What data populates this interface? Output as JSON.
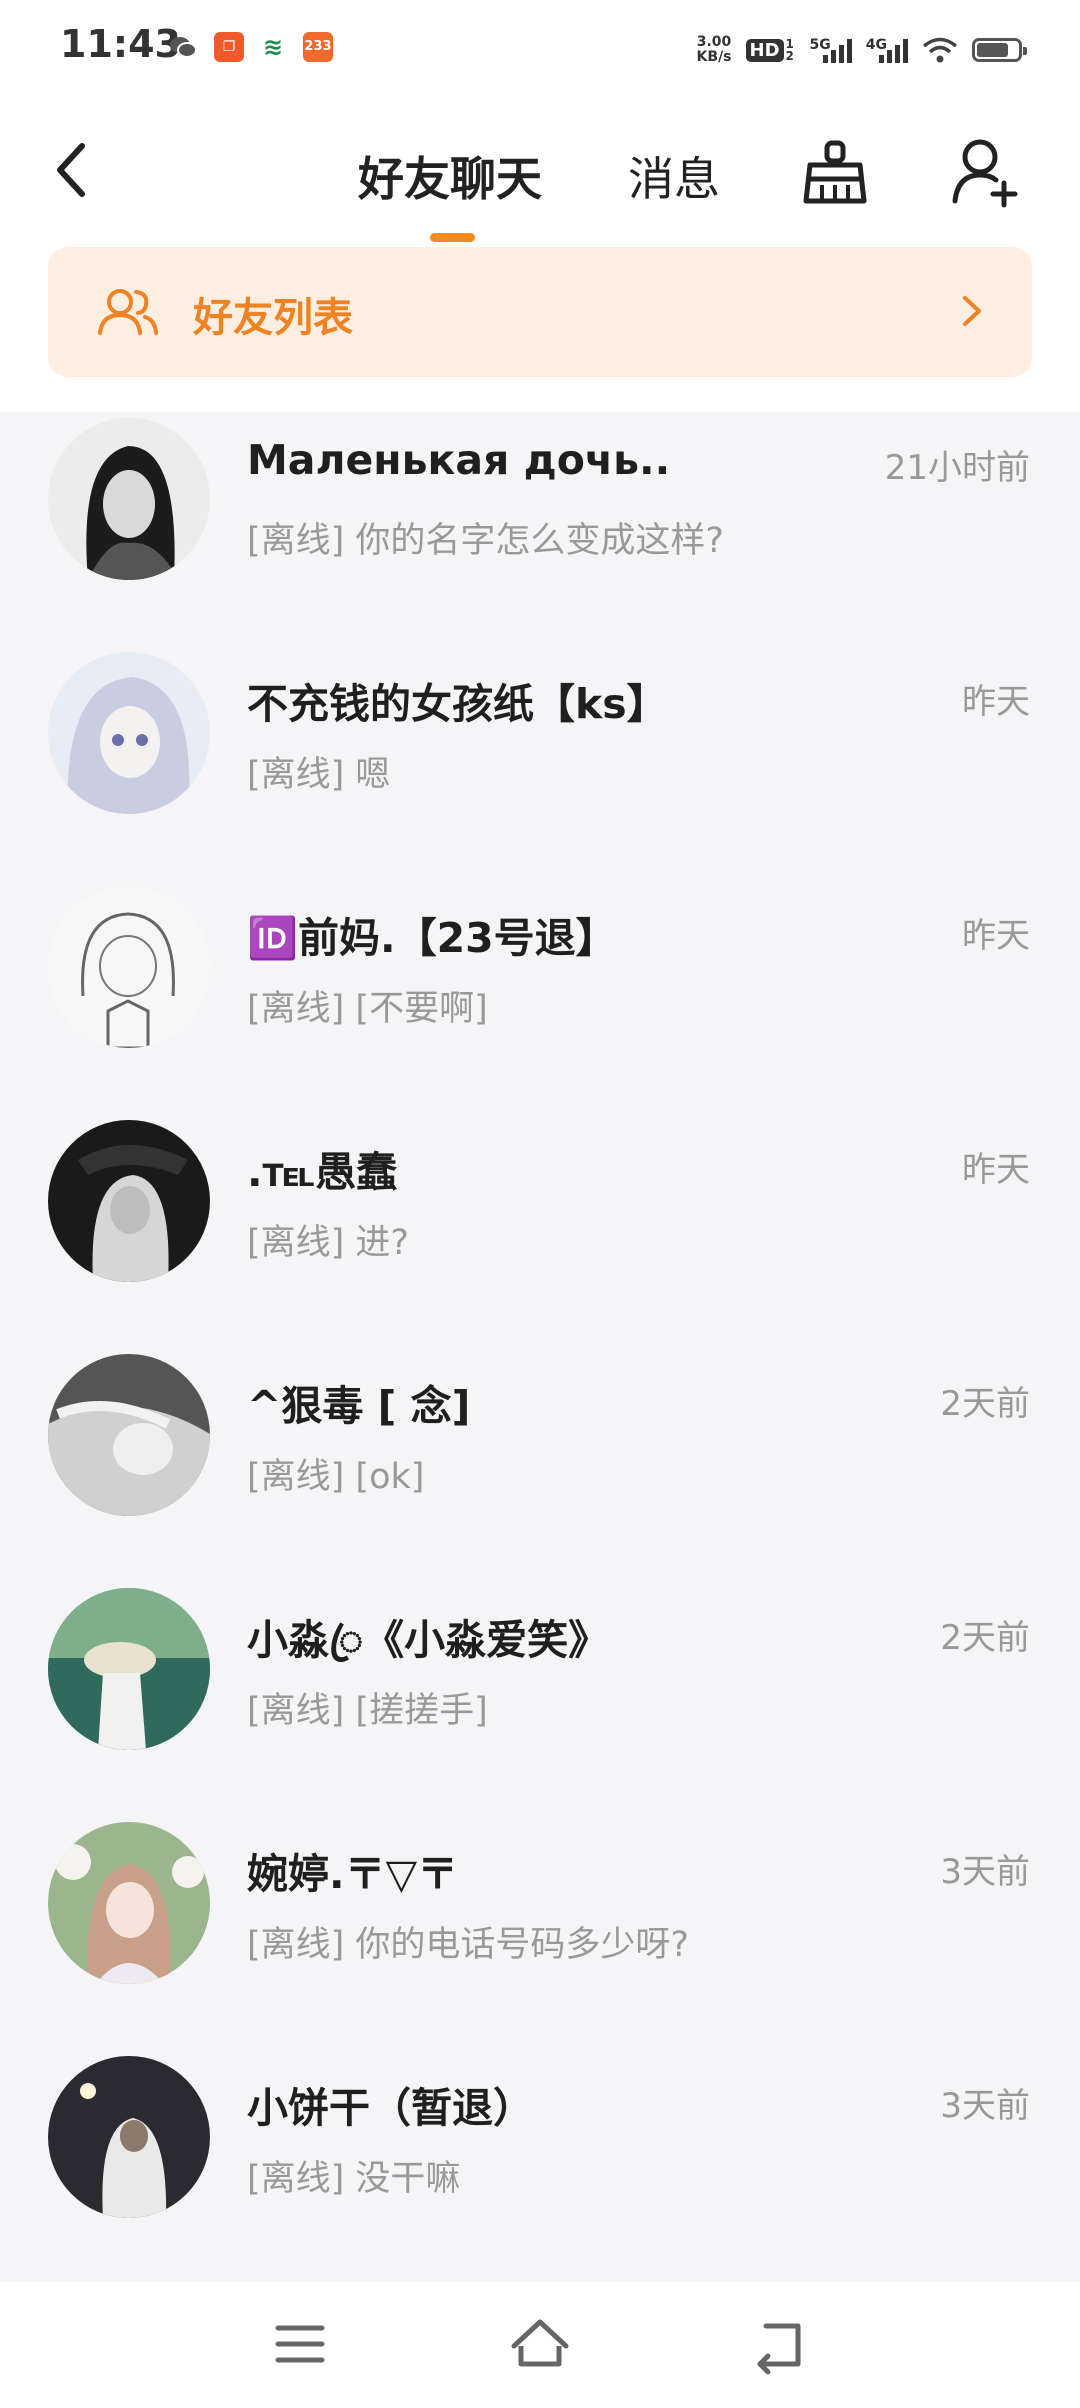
{
  "status_bar": {
    "time": "11:43",
    "net_speed_value": "3.00",
    "net_speed_unit": "KB/s",
    "hd_label": "HD",
    "hd_sub": "1 2",
    "signal_1": "5G",
    "signal_2": "4G",
    "app_icons": [
      "wechat-icon",
      "app-icon-orange",
      "app-icon-green",
      "app-icon-233"
    ],
    "app_233_label": "233"
  },
  "header": {
    "tab_active": "好友聊天",
    "tab_inactive": "消息",
    "accent_color": "#f58a1f"
  },
  "friends_banner": {
    "label": "好友列表"
  },
  "chats": [
    {
      "name": "Маленькая дочь..",
      "time": "21小时前",
      "message": "[离线] 你的名字怎么变成这样?"
    },
    {
      "name": "不充钱的女孩纸【ks】",
      "time": "昨天",
      "message": "[离线] 嗯"
    },
    {
      "name": "🆔前妈.【23号退】",
      "time": "昨天",
      "message": "[离线] [不要啊]"
    },
    {
      "name": ".℡愚蠢",
      "time": "昨天",
      "message": "[离线] 进?"
    },
    {
      "name": "^狠毒   [ 念]",
      "time": "2天前",
      "message": "[离线] [ok]"
    },
    {
      "name": "小淼ꦿ《小淼爱笑》",
      "time": "2天前",
      "message": "[离线] [搓搓手]"
    },
    {
      "name": "婉婷.〒▽〒",
      "time": "3天前",
      "message": "[离线] 你的电话号码多少呀?"
    },
    {
      "name": "小饼干（暂退）",
      "time": "3天前",
      "message": "[离线] 没干嘛"
    }
  ]
}
